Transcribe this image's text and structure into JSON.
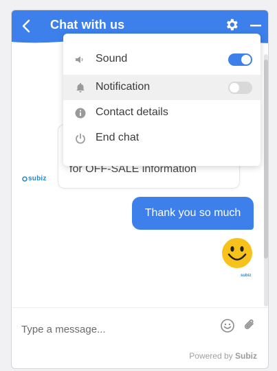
{
  "header": {
    "title": "Chat with us",
    "accent_color": "#3d80ec"
  },
  "menu": {
    "items": [
      {
        "label": "Sound",
        "icon": "speaker-icon",
        "toggle": "on"
      },
      {
        "label": "Notification",
        "icon": "bell-icon",
        "toggle": "off"
      },
      {
        "label": "Contact details",
        "icon": "info-icon"
      },
      {
        "label": "End chat",
        "icon": "power-icon"
      }
    ]
  },
  "messages": {
    "agent_text": "for OFF-SALE information",
    "agent_logo": "subiz",
    "user_text": "Thank you so much",
    "sticker": "smiley-emoji",
    "small_logo": "subiz"
  },
  "composer": {
    "placeholder": "Type a message...",
    "powered_prefix": "Powered by",
    "powered_brand": "Subiz"
  }
}
